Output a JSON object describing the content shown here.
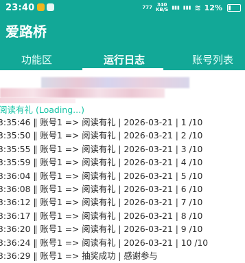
{
  "status_bar": {
    "time": "23:40",
    "speed_value": "340",
    "speed_unit": "KB/S",
    "battery": "12%"
  },
  "app": {
    "title": "爱路桥"
  },
  "tabs": [
    {
      "label": "功能区",
      "active": false
    },
    {
      "label": "运行日志",
      "active": true
    },
    {
      "label": "账号列表",
      "active": false
    }
  ],
  "log": {
    "loading": "阅读有礼 (Loading...)",
    "lines": [
      "3:35:46 ‖ 账号1 => 阅读有礼 | 2026-03-21 | 1 /10",
      "3:35:50 ‖ 账号1 => 阅读有礼 | 2026-03-21 | 2 /10",
      "3:35:55 ‖ 账号1 => 阅读有礼 | 2026-03-21 | 3 /10",
      "3:35:59 ‖ 账号1 => 阅读有礼 | 2026-03-21 | 4 /10",
      "3:36:04 ‖ 账号1 => 阅读有礼 | 2026-03-21 | 5 /10",
      "3:36:08 ‖ 账号1 => 阅读有礼 | 2026-03-21 | 6 /10",
      "3:36:12 ‖ 账号1 => 阅读有礼 | 2026-03-21 | 7 /10",
      "3:36:17 ‖ 账号1 => 阅读有礼 | 2026-03-21 | 8 /10",
      "3:36:20 ‖ 账号1 => 阅读有礼 | 2026-03-21 | 9 /10",
      "3:36:24 ‖ 账号1 => 阅读有礼 | 2026-03-21 | 10 /10",
      "3:36:29 ‖ 账号1 => 抽奖成功 | 感谢参与"
    ]
  },
  "colors": {
    "primary": "#12a897",
    "loading_text": "#18c4a6",
    "log_text": "#2b2b2b"
  }
}
